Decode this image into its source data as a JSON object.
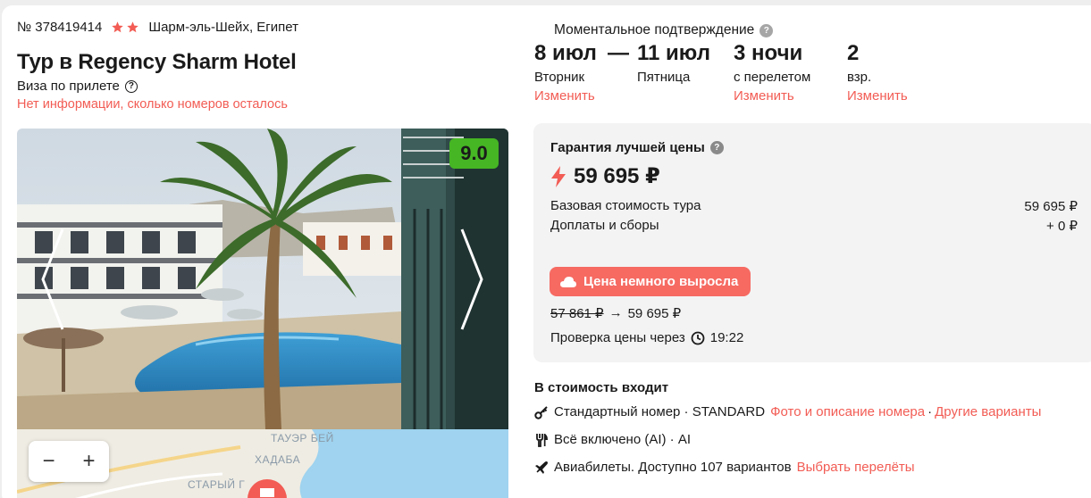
{
  "header": {
    "tour_number": "№ 378419414",
    "stars": 2,
    "location": "Шарм-эль-Шейх, Египет",
    "title": "Тур в Regency Sharm Hotel",
    "visa": "Виза по прилете",
    "visa_icon": "question-circle-icon",
    "rooms_note": "Нет информации, сколько номеров осталось"
  },
  "gallery": {
    "rating": "9.0",
    "rating_color": "#46b624",
    "prev_icon": "chevron-left-icon",
    "next_icon": "chevron-right-icon"
  },
  "map": {
    "labels": [
      "ТАУЭР БЕЙ",
      "ХАДАБА",
      "СТАРЫЙ Г"
    ],
    "zoom_out": "−",
    "zoom_in": "+"
  },
  "booking": {
    "confirmation": "Моментальное подтверждение",
    "date_from": "8 июл",
    "date_from_day": "Вторник",
    "dash": "—",
    "date_to": "11 июл",
    "date_to_day": "Пятница",
    "change_dates": "Изменить",
    "nights": "3 ночи",
    "nights_note": "с перелетом",
    "change_nights": "Изменить",
    "guests": "2",
    "guests_note": "взр.",
    "change_guests": "Изменить"
  },
  "price": {
    "guarantee": "Гарантия лучшей цены",
    "total": "59 695 ₽",
    "base_label": "Базовая стоимость тура",
    "base_value": "59 695 ₽",
    "fees_label": "Доплаты и сборы",
    "fees_value": "+ 0 ₽",
    "alert": "Цена немного выросла",
    "old_price": "57 861 ₽",
    "arrow": "→",
    "new_price": "59 695 ₽",
    "check_label": "Проверка цены через",
    "check_time": "19:22",
    "accent": "#f25c54"
  },
  "included": {
    "title": "В стоимость входит",
    "room_text": "Стандартный номер · STANDARD",
    "room_link": "Фото и описание номера",
    "sep": "·",
    "room_link2": "Другие варианты",
    "meal": "Всё включено (AI) · AI",
    "flights_text": "Авиабилеты. Доступно 107 вариантов",
    "flights_link": "Выбрать перелёты"
  }
}
